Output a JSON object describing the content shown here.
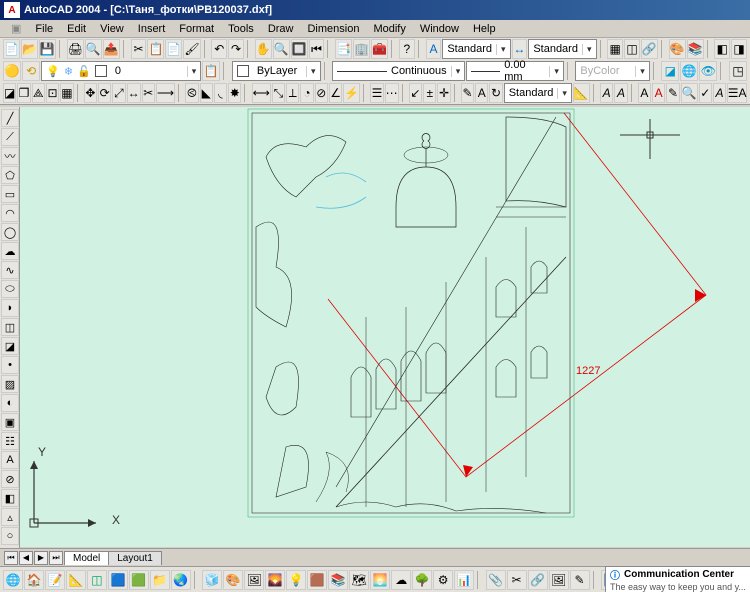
{
  "title": {
    "app": "AutoCAD 2004",
    "doc": "[C:\\Таня_фотки\\PB120037.dxf]"
  },
  "menu": {
    "file": "File",
    "edit": "Edit",
    "view": "View",
    "insert": "Insert",
    "format": "Format",
    "tools": "Tools",
    "draw": "Draw",
    "dimension": "Dimension",
    "modify": "Modify",
    "window": "Window",
    "help": "Help"
  },
  "props": {
    "layer": "0",
    "bylayer": "ByLayer",
    "linetype": "Continuous",
    "lineweight": "0.00 mm",
    "bycolor": "ByColor"
  },
  "styles": {
    "textstyle": "Standard",
    "dimstyle": "Standard",
    "tablestyle": "Standard"
  },
  "dims": {
    "value": "1227"
  },
  "axes": {
    "x": "X",
    "y": "Y"
  },
  "tabs": {
    "model": "Model",
    "layout1": "Layout1"
  },
  "comm": {
    "title": "Communication Center",
    "sub": "The easy way to keep you and y..."
  },
  "colors": {
    "accent": "#0a246a",
    "canvas": "#d1f2e2",
    "dim": "#d00000"
  }
}
